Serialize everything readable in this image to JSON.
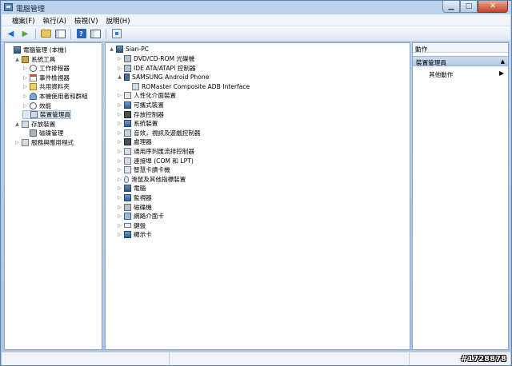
{
  "window": {
    "title": "電腦管理"
  },
  "menu": [
    "檔案(F)",
    "執行(A)",
    "檢視(V)",
    "說明(H)"
  ],
  "left_tree": [
    {
      "label": "電腦管理 (本機)",
      "depth": 0,
      "icon": "computer-icon",
      "expander": ""
    },
    {
      "label": "系統工具",
      "depth": 1,
      "icon": "tools-icon",
      "expander": "▲"
    },
    {
      "label": "工作排程器",
      "depth": 2,
      "icon": "clock-icon",
      "expander": "▷"
    },
    {
      "label": "事件檢視器",
      "depth": 2,
      "icon": "event-viewer-icon",
      "expander": "▷"
    },
    {
      "label": "共用資料夾",
      "depth": 2,
      "icon": "shared-folder-icon",
      "expander": "▷"
    },
    {
      "label": "本機使用者和群組",
      "depth": 2,
      "icon": "users-icon",
      "expander": "▷"
    },
    {
      "label": "效能",
      "depth": 2,
      "icon": "performance-icon",
      "expander": "▷"
    },
    {
      "label": "裝置管理員",
      "depth": 2,
      "icon": "device-manager-icon",
      "expander": "",
      "selected": true
    },
    {
      "label": "存放裝置",
      "depth": 1,
      "icon": "storage-icon",
      "expander": "▲"
    },
    {
      "label": "磁碟管理",
      "depth": 2,
      "icon": "disk-icon",
      "expander": ""
    },
    {
      "label": "服務與應用程式",
      "depth": 1,
      "icon": "services-icon",
      "expander": "▷"
    }
  ],
  "device_tree": {
    "root": "Sian-PC",
    "items": [
      {
        "label": "DVD/CD-ROM 光碟機",
        "depth": 1,
        "icon": "dvd-drive-icon",
        "expander": "▷"
      },
      {
        "label": "IDE ATA/ATAPI 控制器",
        "depth": 1,
        "icon": "ide-controller-icon",
        "expander": "▷"
      },
      {
        "label": "SAMSUNG Android Phone",
        "depth": 1,
        "icon": "phone-icon",
        "expander": "▲"
      },
      {
        "label": "ROMaster Composite ADB Interface",
        "depth": 2,
        "icon": "adb-interface-icon",
        "expander": ""
      },
      {
        "label": "人性化介面裝置",
        "depth": 1,
        "icon": "hid-icon",
        "expander": "▷"
      },
      {
        "label": "可攜式裝置",
        "depth": 1,
        "icon": "portable-device-icon",
        "expander": "▷"
      },
      {
        "label": "存放控制器",
        "depth": 1,
        "icon": "storage-controller-icon",
        "expander": "▷"
      },
      {
        "label": "系統裝置",
        "depth": 1,
        "icon": "system-device-icon",
        "expander": "▷"
      },
      {
        "label": "音效，視訊及遊戲控制器",
        "depth": 1,
        "icon": "sound-icon",
        "expander": "▷"
      },
      {
        "label": "處理器",
        "depth": 1,
        "icon": "processor-icon",
        "expander": "▷"
      },
      {
        "label": "通用序列匯流排控制器",
        "depth": 1,
        "icon": "usb-icon",
        "expander": "▷"
      },
      {
        "label": "連接埠 (COM 和 LPT)",
        "depth": 1,
        "icon": "port-icon",
        "expander": "▷"
      },
      {
        "label": "智慧卡讀卡機",
        "depth": 1,
        "icon": "smart-card-icon",
        "expander": "▷"
      },
      {
        "label": "滑鼠及其他指標裝置",
        "depth": 1,
        "icon": "mouse-icon",
        "expander": "▷"
      },
      {
        "label": "電腦",
        "depth": 1,
        "icon": "computer-icon",
        "expander": "▷"
      },
      {
        "label": "監視器",
        "depth": 1,
        "icon": "monitor-icon",
        "expander": "▷"
      },
      {
        "label": "磁碟機",
        "depth": 1,
        "icon": "disk-drive-icon",
        "expander": "▷"
      },
      {
        "label": "網路介面卡",
        "depth": 1,
        "icon": "network-adapter-icon",
        "expander": "▷"
      },
      {
        "label": "鍵盤",
        "depth": 1,
        "icon": "keyboard-icon",
        "expander": "▷"
      },
      {
        "label": "顯示卡",
        "depth": 1,
        "icon": "display-adapter-icon",
        "expander": "▷"
      }
    ]
  },
  "actions": {
    "header": "動作",
    "section": "裝置管理員",
    "item": "其他動作"
  },
  "watermark": "#1728878",
  "colors": {
    "selection": "#dce9f7",
    "titlebar": "#bcd3ee",
    "close_button": "#c4432a"
  }
}
